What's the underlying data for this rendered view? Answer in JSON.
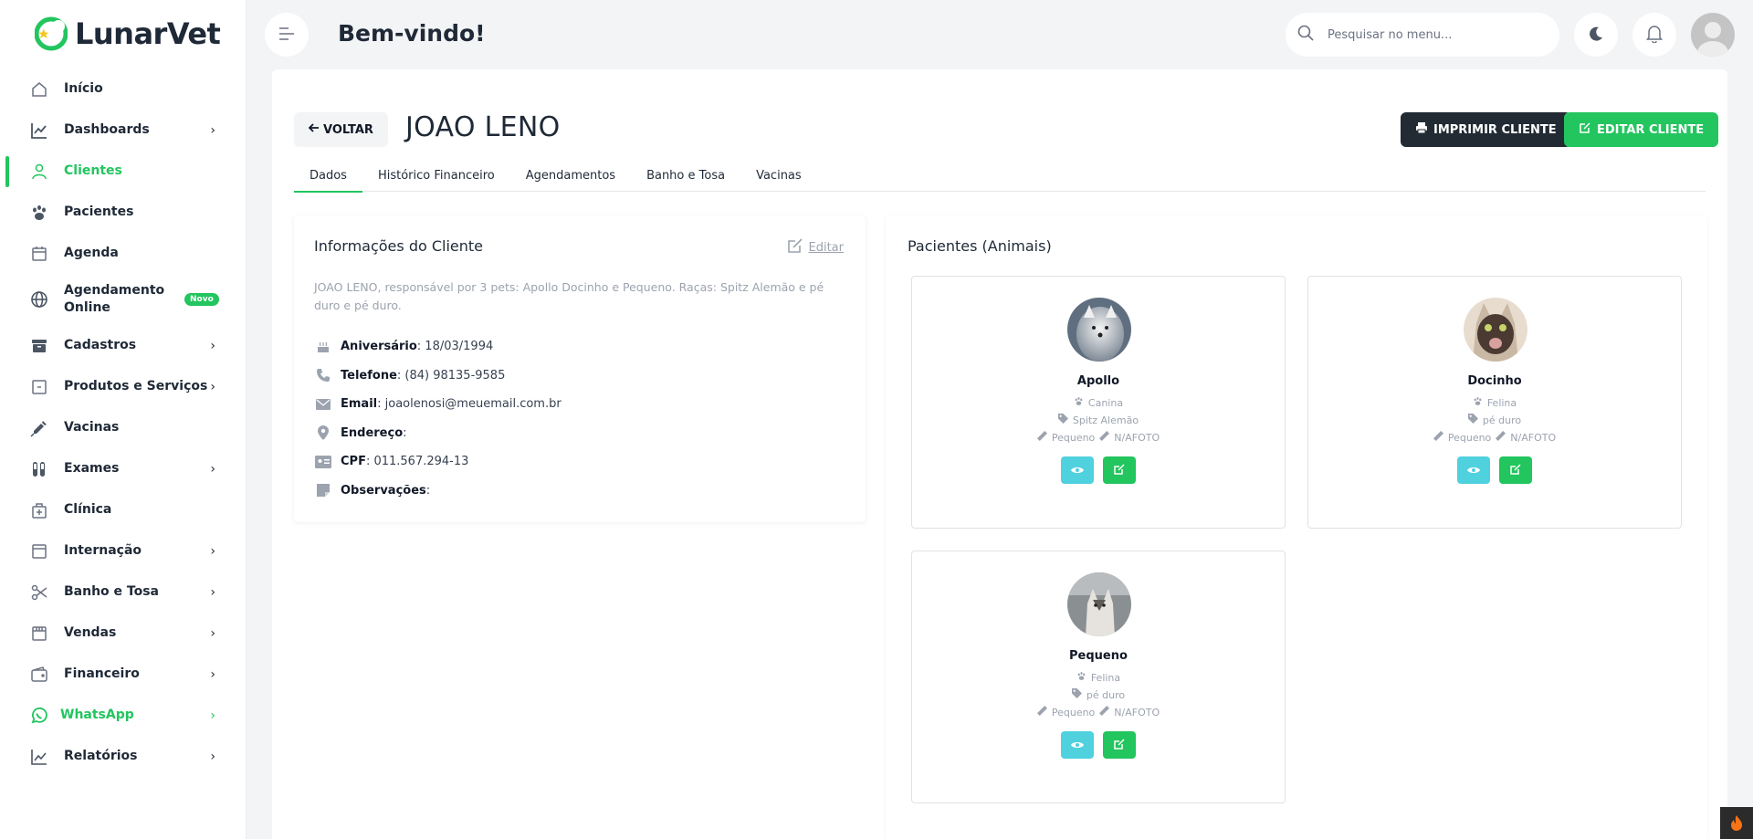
{
  "app": {
    "name": "LunarVet"
  },
  "sidebar": {
    "items": [
      {
        "label": "Início",
        "icon": "home-icon"
      },
      {
        "label": "Dashboards",
        "icon": "chart-line-icon"
      },
      {
        "label": "Clientes",
        "icon": "user-icon"
      },
      {
        "label": "Pacientes",
        "icon": "paw-icon"
      },
      {
        "label": "Agenda",
        "icon": "calendar-icon"
      },
      {
        "label": "Agendamento Online",
        "icon": "globe-icon",
        "badge": "Novo"
      },
      {
        "label": "Cadastros",
        "icon": "archive-icon"
      },
      {
        "label": "Produtos e Serviços",
        "icon": "box-icon"
      },
      {
        "label": "Vacinas",
        "icon": "syringe-icon"
      },
      {
        "label": "Exames",
        "icon": "test-tube-icon"
      },
      {
        "label": "Clínica",
        "icon": "clinic-icon"
      },
      {
        "label": "Internação",
        "icon": "hospital-icon"
      },
      {
        "label": "Banho e Tosa",
        "icon": "scissors-icon"
      },
      {
        "label": "Vendas",
        "icon": "store-icon"
      },
      {
        "label": "Financeiro",
        "icon": "wallet-icon"
      },
      {
        "label": "WhatsApp",
        "icon": "whatsapp-icon"
      },
      {
        "label": "Relatórios",
        "icon": "report-chart-icon"
      }
    ]
  },
  "header": {
    "welcome": "Bem-vindo!",
    "search_placeholder": "Pesquisar no menu..."
  },
  "client": {
    "back_label": "VOLTAR",
    "name": "JOAO LENO",
    "print_label": "IMPRIMIR CLIENTE",
    "edit_label": "EDITAR CLIENTE",
    "tabs": [
      "Dados",
      "Histórico Financeiro",
      "Agendamentos",
      "Banho e Tosa",
      "Vacinas"
    ],
    "info": {
      "title": "Informações do Cliente",
      "edit_label": "Editar",
      "description": "JOAO LENO, responsável por 3 pets: Apollo Docinho e Pequeno. Raças: Spitz Alemão e pé duro e pé duro.",
      "rows": [
        {
          "label": "Aniversário",
          "value": ": 18/03/1994",
          "icon": "cake-icon"
        },
        {
          "label": "Telefone",
          "value": ": (84) 98135-9585",
          "icon": "phone-icon"
        },
        {
          "label": "Email",
          "value": ": joaolenosi@meuemail.com.br",
          "icon": "envelope-icon"
        },
        {
          "label": "Endereço",
          "value": ":",
          "icon": "map-pin-icon"
        },
        {
          "label": "CPF",
          "value": ": 011.567.294-13",
          "icon": "id-card-icon"
        },
        {
          "label": "Observações",
          "value": ":",
          "icon": "note-icon"
        }
      ]
    },
    "patients": {
      "title": "Pacientes (Animais)",
      "items": [
        {
          "name": "Apollo",
          "species": "Canina",
          "breed": "Spitz Alemão",
          "size": "Pequeno",
          "coat": "N/AFOTO"
        },
        {
          "name": "Docinho",
          "species": "Felina",
          "breed": "pé duro",
          "size": "Pequeno",
          "coat": "N/AFOTO"
        },
        {
          "name": "Pequeno",
          "species": "Felina",
          "breed": "pé duro",
          "size": "Pequeno",
          "coat": "N/AFOTO"
        }
      ]
    }
  }
}
